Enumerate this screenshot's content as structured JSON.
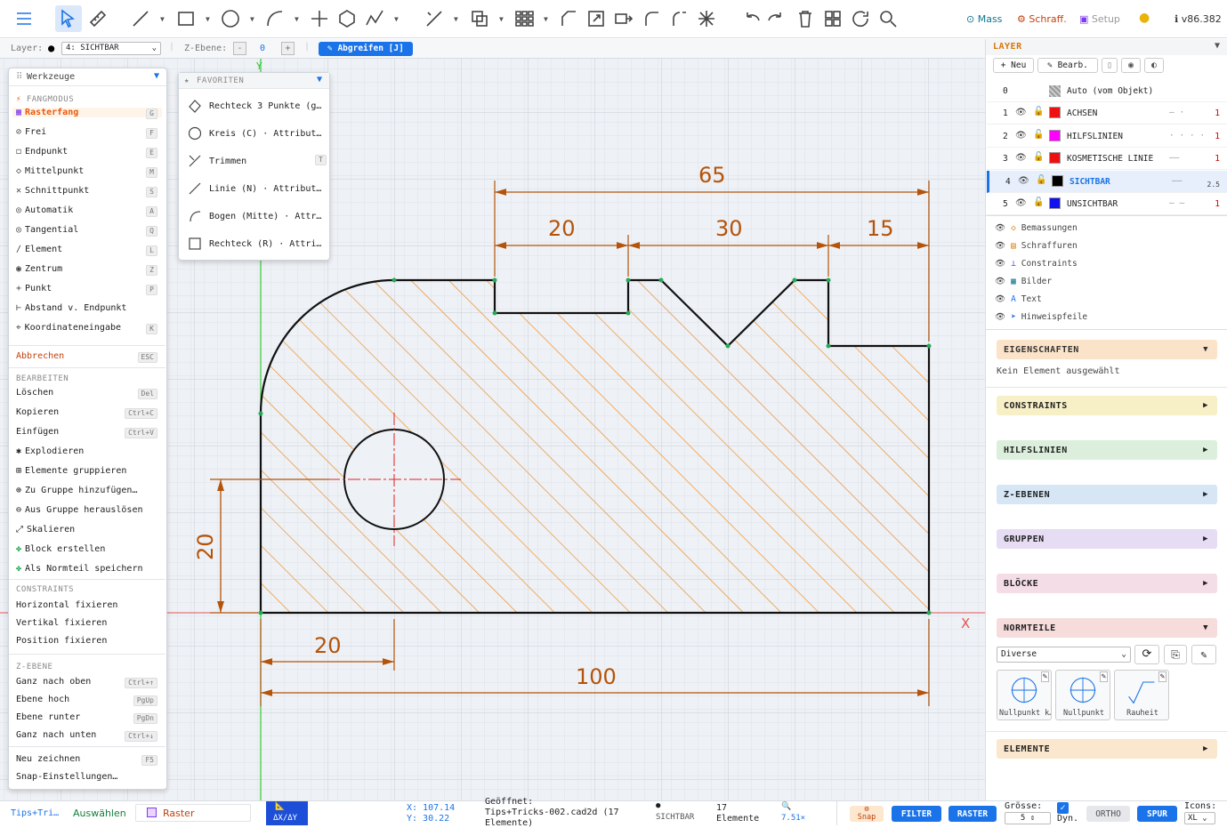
{
  "toolbar": {
    "right": {
      "mass": "Mass",
      "schraff": "Schraff.",
      "setup": "Setup",
      "version": "v86.382"
    }
  },
  "layerbar": {
    "layer_label": "Layer:",
    "layer_value": "4: SICHTBAR",
    "zebene_label": "Z-Ebene:",
    "zebene_value": "0",
    "abgreifen": "Abgreifen [J]"
  },
  "werkzeuge": {
    "title": "Werkzeuge",
    "fangmodus_title": "FANGMODUS",
    "snap_items": [
      {
        "label": "Rasterfang",
        "key": "G"
      },
      {
        "label": "Frei",
        "key": "F"
      },
      {
        "label": "Endpunkt",
        "key": "E"
      },
      {
        "label": "Mittelpunkt",
        "key": "M"
      },
      {
        "label": "Schnittpunkt",
        "key": "S"
      },
      {
        "label": "Automatik",
        "key": "A"
      },
      {
        "label": "Tangential",
        "key": "Q"
      },
      {
        "label": "Element",
        "key": "L"
      },
      {
        "label": "Zentrum",
        "key": "Z"
      },
      {
        "label": "Punkt",
        "key": "P"
      },
      {
        "label": "Abstand v. Endpunkt",
        "key": ""
      },
      {
        "label": "Koordinateneingabe",
        "key": "K"
      }
    ],
    "abbrechen": {
      "label": "Abbrechen",
      "key": "ESC"
    },
    "bearbeiten_title": "BEARBEITEN",
    "edit_items": [
      {
        "label": "Löschen",
        "key": "Del"
      },
      {
        "label": "Kopieren",
        "key": "Ctrl+C"
      },
      {
        "label": "Einfügen",
        "key": "Ctrl+V"
      },
      {
        "label": "Explodieren",
        "key": ""
      },
      {
        "label": "Elemente gruppieren",
        "key": ""
      },
      {
        "label": "Zu Gruppe hinzufügen…",
        "key": ""
      },
      {
        "label": "Aus Gruppe herauslösen",
        "key": ""
      },
      {
        "label": "Skalieren",
        "key": ""
      },
      {
        "label": "Block erstellen",
        "key": ""
      },
      {
        "label": "Als Normteil speichern",
        "key": ""
      }
    ],
    "constraints_title": "CONSTRAINTS",
    "constraint_items": [
      "Horizontal fixieren",
      "Vertikal fixieren",
      "Position fixieren"
    ],
    "zebene_title": "Z-EBENE",
    "z_items": [
      {
        "label": "Ganz nach oben",
        "key": "Ctrl+↑"
      },
      {
        "label": "Ebene hoch",
        "key": "PgUp"
      },
      {
        "label": "Ebene runter",
        "key": "PgDn"
      },
      {
        "label": "Ganz nach unten",
        "key": "Ctrl+↓"
      }
    ],
    "neu_zeichnen": {
      "label": "Neu zeichnen",
      "key": "F5"
    },
    "snap_settings": "Snap-Einstellungen…"
  },
  "favoriten": {
    "title": "FAVORITEN",
    "items": [
      {
        "label": "Rechteck 3 Punkte (g…",
        "key": ""
      },
      {
        "label": "Kreis (C) · Attribut…",
        "key": ""
      },
      {
        "label": "Trimmen",
        "key": "T"
      },
      {
        "label": "Linie (N) · Attribut…",
        "key": ""
      },
      {
        "label": "Bogen (Mitte) · Attr…",
        "key": ""
      },
      {
        "label": "Rechteck (R) · Attri…",
        "key": ""
      }
    ]
  },
  "drawing": {
    "dims": {
      "d65": "65",
      "d20a": "20",
      "d30": "30",
      "d15": "15",
      "d20v": "20",
      "d20b": "20",
      "d100": "100"
    },
    "axis_x": "X",
    "axis_y": "Y"
  },
  "layers": {
    "title": "LAYER",
    "buttons": [
      "Neu",
      "Bearb."
    ],
    "auto": {
      "num": "0",
      "name": "Auto (vom Objekt)"
    },
    "rows": [
      {
        "num": "1",
        "name": "ACHSEN",
        "color": "#ee1111",
        "width": "1"
      },
      {
        "num": "2",
        "name": "HILFSLINIEN",
        "color": "#ff00ff",
        "width": "1"
      },
      {
        "num": "3",
        "name": "KOSMETISCHE LINIE",
        "color": "#ee1111",
        "width": "1"
      },
      {
        "num": "4",
        "name": "SICHTBAR",
        "color": "#000000",
        "width": "2.5"
      },
      {
        "num": "5",
        "name": "UNSICHTBAR",
        "color": "#1111ee",
        "width": "1"
      }
    ],
    "sublayers": [
      "Bemassungen",
      "Schraffuren",
      "Constraints",
      "Bilder",
      "Text",
      "Hinweispfeile"
    ]
  },
  "props": {
    "eigenschaften": "EIGENSCHAFTEN",
    "none_selected": "Kein Element ausgewählt",
    "constraints": "CONSTRAINTS",
    "hilfslinien": "HILFSLINIEN",
    "zebenen": "Z-EBENEN",
    "gruppen": "GRUPPEN",
    "bloecke": "BLÖCKE",
    "normteile": "NORMTEILE",
    "normteile_select": "Diverse",
    "normteile_items": [
      "Nullpunkt k…",
      "Nullpunkt",
      "Rauheit"
    ],
    "elemente": "ELEMENTE"
  },
  "status": {
    "tips": "Tips+Tri…",
    "mode": "Auswählen",
    "raster": "Raster",
    "dxdy": "ΔX/ΔY",
    "x": "X: 107.14",
    "y": "Y: 30.22",
    "opened_l1": "Geöffnet:",
    "opened_l2": "Tips+Tricks-002.cad2d (17",
    "opened_l3": "Elemente)",
    "layer": "SICHTBAR",
    "count_l1": "17",
    "count_l2": "Elemente",
    "zoom": "7.51×",
    "snap": "Snap",
    "filter": "FILTER",
    "raster_btn": "RASTER",
    "groesse": "Grösse:",
    "groesse_val": "5",
    "dyn": "Dyn.",
    "ortho": "ORTHO",
    "spur": "SPUR",
    "icons": "Icons:",
    "icons_val": "XL"
  }
}
